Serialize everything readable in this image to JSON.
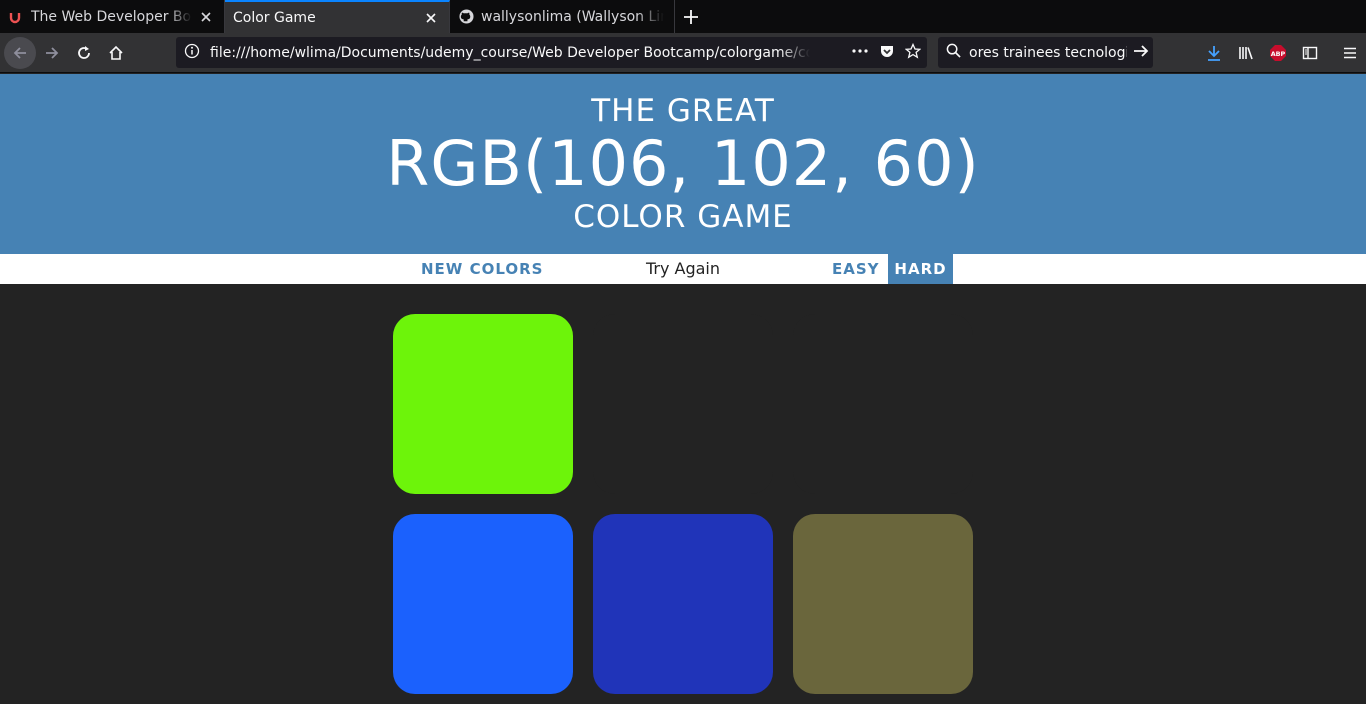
{
  "browser": {
    "tabs": [
      {
        "title": "The Web Developer Bootcamp",
        "favicon": "udemy-icon",
        "active": false
      },
      {
        "title": "Color Game",
        "favicon": "",
        "active": true
      },
      {
        "title": "wallysonlima (Wallyson Lima)",
        "favicon": "github-icon",
        "active": false
      }
    ],
    "url": "file:///home/wlima/Documents/udemy_course/Web Developer Bootcamp/colorgame/colorgame.html",
    "search": "ores trainees tecnologia"
  },
  "header": {
    "line1": "THE GREAT",
    "target_rgb": "RGB(106, 102, 60)",
    "line3": "COLOR GAME"
  },
  "stripe": {
    "new_colors": "NEW COLORS",
    "message": "Try Again",
    "easy": "EASY",
    "hard": "HARD",
    "selected_mode": "HARD"
  },
  "colors": {
    "header_bg": "#4682b4",
    "body_bg": "#232323",
    "squares": [
      "#6df40a",
      "#232323",
      "#232323",
      "#1b61fd",
      "#2034b9",
      "#6a663c"
    ]
  }
}
